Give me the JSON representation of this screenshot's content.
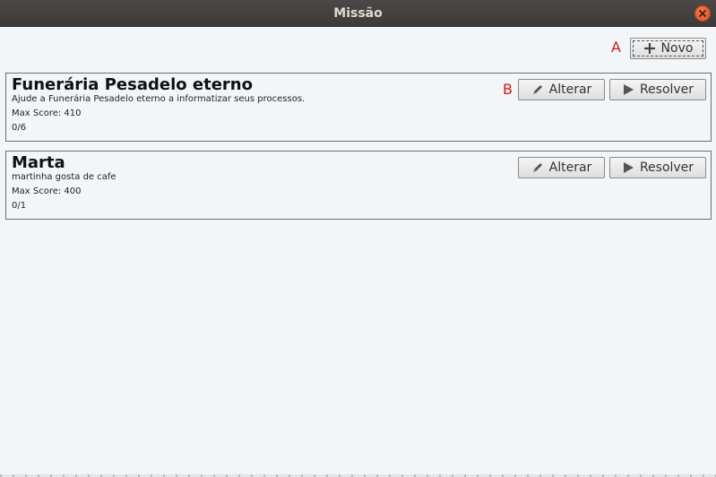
{
  "window": {
    "title": "Missão"
  },
  "annotations": {
    "a": "A",
    "b": "B"
  },
  "toolbar": {
    "new_label": "Novo"
  },
  "missions": [
    {
      "name": "Funerária Pesadelo eterno",
      "description": "Ajude a Funerária Pesadelo eterno a informatizar seus processos.",
      "max_score": "Max Score: 410",
      "progress": "0/6",
      "edit_label": "Alterar",
      "solve_label": "Resolver"
    },
    {
      "name": "Marta",
      "description": "martinha gosta de cafe",
      "max_score": "Max Score: 400",
      "progress": "0/1",
      "edit_label": "Alterar",
      "solve_label": "Resolver"
    }
  ],
  "icons": {
    "close": "close-icon",
    "new": "plus-icon",
    "edit": "pencil-icon",
    "solve": "play-icon"
  },
  "colors": {
    "annotation": "#cc1b1b",
    "close": "#e0531f",
    "titlebar": "#3c3b39"
  }
}
